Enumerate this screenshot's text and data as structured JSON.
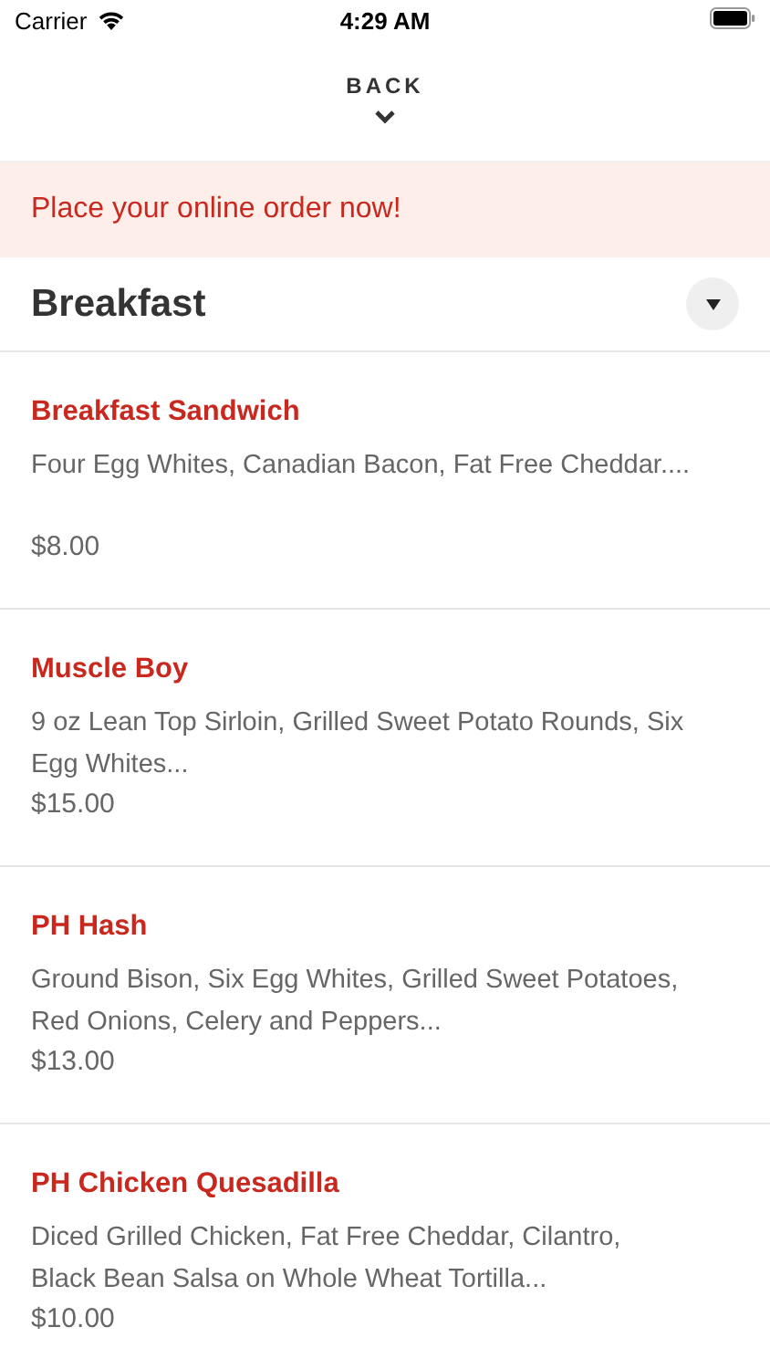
{
  "status_bar": {
    "carrier": "Carrier",
    "time": "4:29 AM"
  },
  "header": {
    "back_label": "BACK"
  },
  "banner": {
    "text": "Place your online order now!"
  },
  "section": {
    "title": "Breakfast",
    "expanded": true
  },
  "items": [
    {
      "name": "Breakfast Sandwich",
      "description_lines": [
        "Four Egg Whites, Canadian Bacon, Fat Free Cheddar...."
      ],
      "price": "$8.00"
    },
    {
      "name": "Muscle Boy",
      "description_lines": [
        "9 oz Lean Top Sirloin, Grilled Sweet Potato Rounds, Six",
        "Egg Whites..."
      ],
      "price": "$15.00"
    },
    {
      "name": "PH Hash",
      "description_lines": [
        "Ground Bison, Six Egg Whites, Grilled Sweet Potatoes,",
        "Red Onions, Celery and Peppers..."
      ],
      "price": "$13.00"
    },
    {
      "name": "PH Chicken Quesadilla",
      "description_lines": [
        "Diced Grilled Chicken, Fat Free Cheddar, Cilantro,",
        "Black Bean Salsa on Whole Wheat Tortilla..."
      ],
      "price": "$10.00"
    }
  ]
}
